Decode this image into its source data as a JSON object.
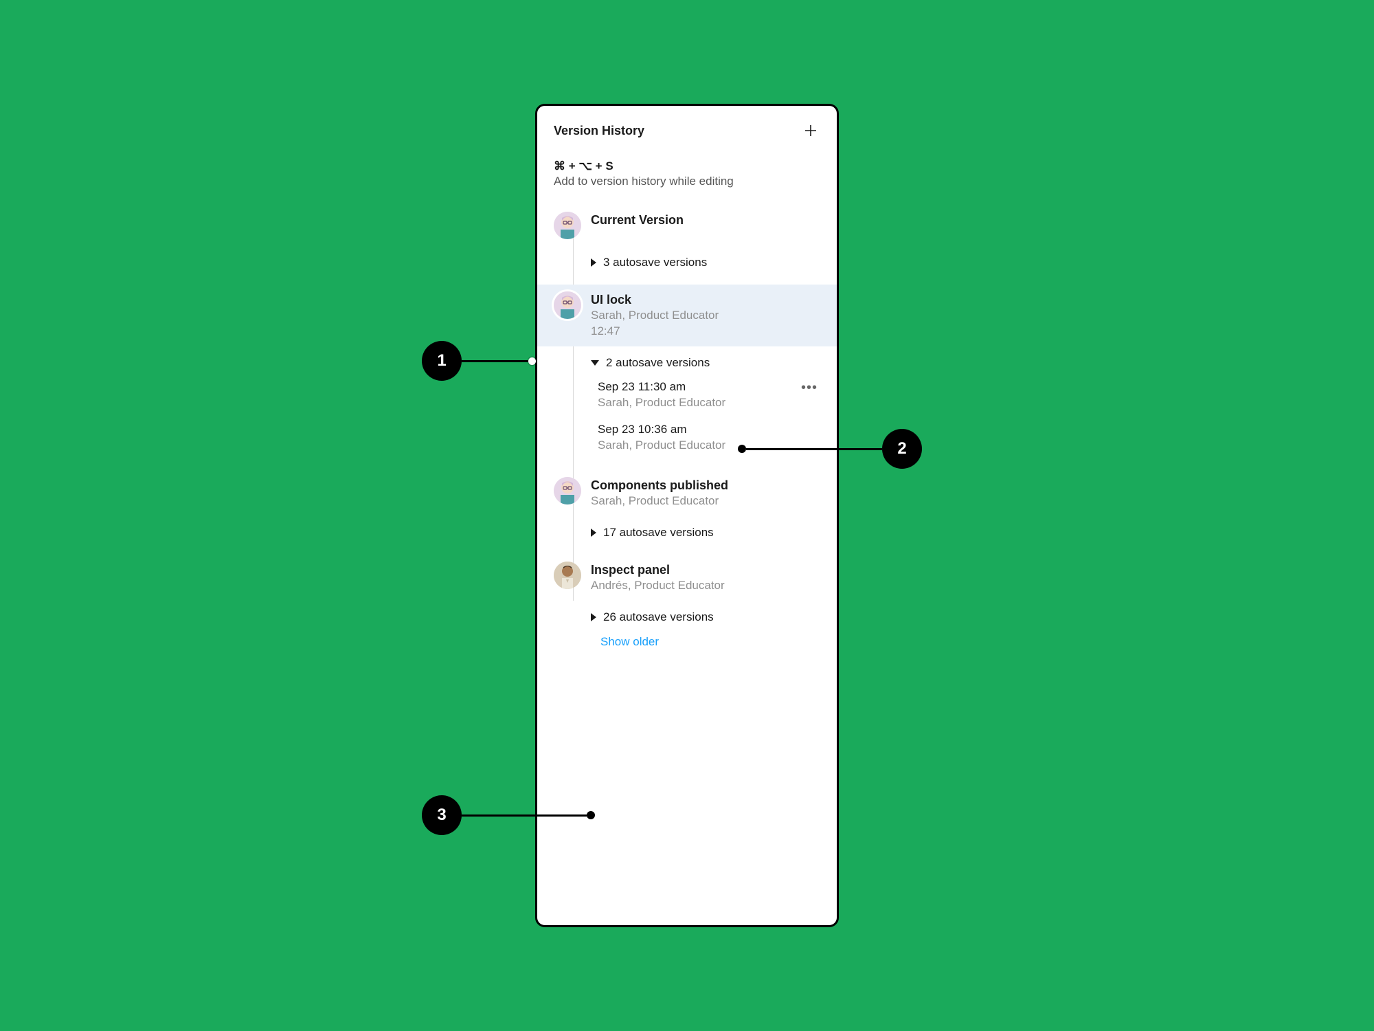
{
  "header": {
    "title": "Version History"
  },
  "shortcut": {
    "keys": "⌘ + ⌥ + S",
    "hint": "Add to version history while editing"
  },
  "entries": {
    "current": {
      "title": "Current Version",
      "autosave": "3 autosave versions"
    },
    "ui_lock": {
      "title": "UI lock",
      "author": "Sarah, Product Educator",
      "time": "12:47",
      "autosave": "2 autosave versions",
      "children": [
        {
          "ts": "Sep 23 11:30 am",
          "author": "Sarah, Product Educator"
        },
        {
          "ts": "Sep 23 10:36 am",
          "author": "Sarah, Product Educator"
        }
      ]
    },
    "components": {
      "title": "Components published",
      "author": "Sarah, Product Educator",
      "autosave": "17 autosave versions"
    },
    "inspect": {
      "title": "Inspect panel",
      "author": "Andrés, Product Educator",
      "autosave": "26 autosave versions"
    }
  },
  "show_older": "Show older",
  "callouts": {
    "1": "1",
    "2": "2",
    "3": "3"
  }
}
